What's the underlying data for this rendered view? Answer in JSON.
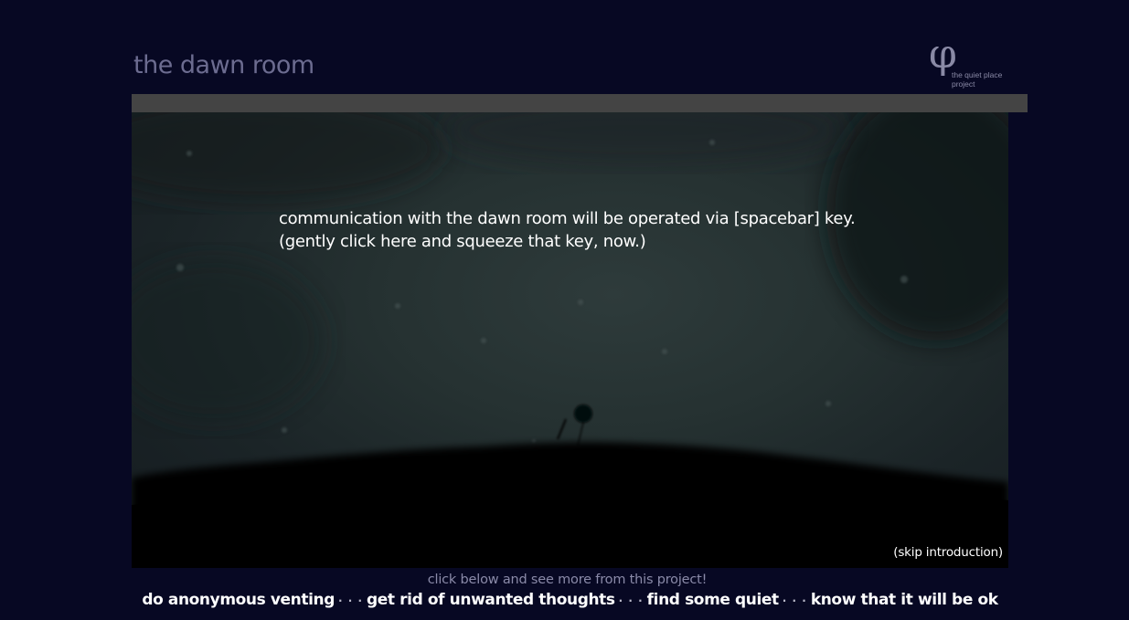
{
  "header": {
    "title": "the dawn room",
    "logo_symbol": "φ",
    "logo_line1": "the quiet place",
    "logo_line2": "project"
  },
  "stage": {
    "intro_line1": "communication with the dawn room will be operated via [spacebar] key.",
    "intro_line2": "(gently click here and squeeze that key, now.)",
    "skip_label": "(skip introduction)"
  },
  "footer": {
    "note": "click below and see more from this project!",
    "separator": "· · ·",
    "links": [
      "do anonymous venting",
      "get rid of unwanted thoughts",
      "find some quiet",
      "know that it will be ok"
    ]
  },
  "colors": {
    "page_background": "#070823",
    "title": "#6c6c90",
    "bar": "#444444"
  }
}
